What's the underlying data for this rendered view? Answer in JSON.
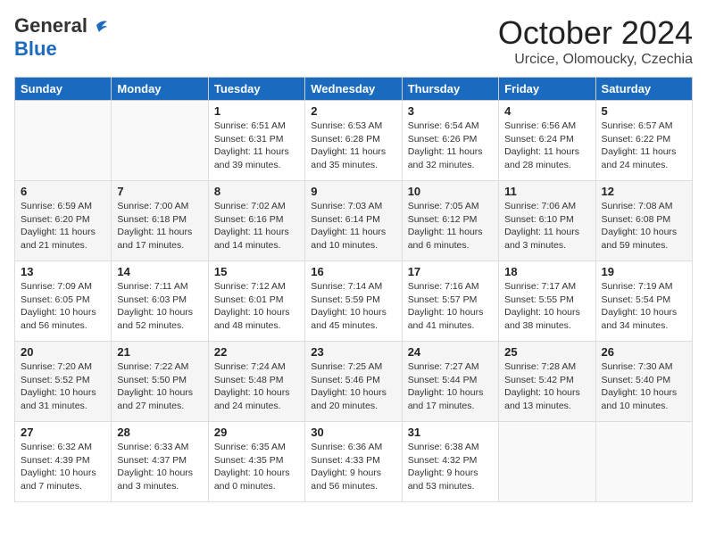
{
  "header": {
    "logo_general": "General",
    "logo_blue": "Blue",
    "month": "October 2024",
    "location": "Urcice, Olomoucky, Czechia"
  },
  "days_of_week": [
    "Sunday",
    "Monday",
    "Tuesday",
    "Wednesday",
    "Thursday",
    "Friday",
    "Saturday"
  ],
  "weeks": [
    [
      {
        "day": "",
        "info": ""
      },
      {
        "day": "",
        "info": ""
      },
      {
        "day": "1",
        "info": "Sunrise: 6:51 AM\nSunset: 6:31 PM\nDaylight: 11 hours\nand 39 minutes."
      },
      {
        "day": "2",
        "info": "Sunrise: 6:53 AM\nSunset: 6:28 PM\nDaylight: 11 hours\nand 35 minutes."
      },
      {
        "day": "3",
        "info": "Sunrise: 6:54 AM\nSunset: 6:26 PM\nDaylight: 11 hours\nand 32 minutes."
      },
      {
        "day": "4",
        "info": "Sunrise: 6:56 AM\nSunset: 6:24 PM\nDaylight: 11 hours\nand 28 minutes."
      },
      {
        "day": "5",
        "info": "Sunrise: 6:57 AM\nSunset: 6:22 PM\nDaylight: 11 hours\nand 24 minutes."
      }
    ],
    [
      {
        "day": "6",
        "info": "Sunrise: 6:59 AM\nSunset: 6:20 PM\nDaylight: 11 hours\nand 21 minutes."
      },
      {
        "day": "7",
        "info": "Sunrise: 7:00 AM\nSunset: 6:18 PM\nDaylight: 11 hours\nand 17 minutes."
      },
      {
        "day": "8",
        "info": "Sunrise: 7:02 AM\nSunset: 6:16 PM\nDaylight: 11 hours\nand 14 minutes."
      },
      {
        "day": "9",
        "info": "Sunrise: 7:03 AM\nSunset: 6:14 PM\nDaylight: 11 hours\nand 10 minutes."
      },
      {
        "day": "10",
        "info": "Sunrise: 7:05 AM\nSunset: 6:12 PM\nDaylight: 11 hours\nand 6 minutes."
      },
      {
        "day": "11",
        "info": "Sunrise: 7:06 AM\nSunset: 6:10 PM\nDaylight: 11 hours\nand 3 minutes."
      },
      {
        "day": "12",
        "info": "Sunrise: 7:08 AM\nSunset: 6:08 PM\nDaylight: 10 hours\nand 59 minutes."
      }
    ],
    [
      {
        "day": "13",
        "info": "Sunrise: 7:09 AM\nSunset: 6:05 PM\nDaylight: 10 hours\nand 56 minutes."
      },
      {
        "day": "14",
        "info": "Sunrise: 7:11 AM\nSunset: 6:03 PM\nDaylight: 10 hours\nand 52 minutes."
      },
      {
        "day": "15",
        "info": "Sunrise: 7:12 AM\nSunset: 6:01 PM\nDaylight: 10 hours\nand 48 minutes."
      },
      {
        "day": "16",
        "info": "Sunrise: 7:14 AM\nSunset: 5:59 PM\nDaylight: 10 hours\nand 45 minutes."
      },
      {
        "day": "17",
        "info": "Sunrise: 7:16 AM\nSunset: 5:57 PM\nDaylight: 10 hours\nand 41 minutes."
      },
      {
        "day": "18",
        "info": "Sunrise: 7:17 AM\nSunset: 5:55 PM\nDaylight: 10 hours\nand 38 minutes."
      },
      {
        "day": "19",
        "info": "Sunrise: 7:19 AM\nSunset: 5:54 PM\nDaylight: 10 hours\nand 34 minutes."
      }
    ],
    [
      {
        "day": "20",
        "info": "Sunrise: 7:20 AM\nSunset: 5:52 PM\nDaylight: 10 hours\nand 31 minutes."
      },
      {
        "day": "21",
        "info": "Sunrise: 7:22 AM\nSunset: 5:50 PM\nDaylight: 10 hours\nand 27 minutes."
      },
      {
        "day": "22",
        "info": "Sunrise: 7:24 AM\nSunset: 5:48 PM\nDaylight: 10 hours\nand 24 minutes."
      },
      {
        "day": "23",
        "info": "Sunrise: 7:25 AM\nSunset: 5:46 PM\nDaylight: 10 hours\nand 20 minutes."
      },
      {
        "day": "24",
        "info": "Sunrise: 7:27 AM\nSunset: 5:44 PM\nDaylight: 10 hours\nand 17 minutes."
      },
      {
        "day": "25",
        "info": "Sunrise: 7:28 AM\nSunset: 5:42 PM\nDaylight: 10 hours\nand 13 minutes."
      },
      {
        "day": "26",
        "info": "Sunrise: 7:30 AM\nSunset: 5:40 PM\nDaylight: 10 hours\nand 10 minutes."
      }
    ],
    [
      {
        "day": "27",
        "info": "Sunrise: 6:32 AM\nSunset: 4:39 PM\nDaylight: 10 hours\nand 7 minutes."
      },
      {
        "day": "28",
        "info": "Sunrise: 6:33 AM\nSunset: 4:37 PM\nDaylight: 10 hours\nand 3 minutes."
      },
      {
        "day": "29",
        "info": "Sunrise: 6:35 AM\nSunset: 4:35 PM\nDaylight: 10 hours\nand 0 minutes."
      },
      {
        "day": "30",
        "info": "Sunrise: 6:36 AM\nSunset: 4:33 PM\nDaylight: 9 hours\nand 56 minutes."
      },
      {
        "day": "31",
        "info": "Sunrise: 6:38 AM\nSunset: 4:32 PM\nDaylight: 9 hours\nand 53 minutes."
      },
      {
        "day": "",
        "info": ""
      },
      {
        "day": "",
        "info": ""
      }
    ]
  ]
}
